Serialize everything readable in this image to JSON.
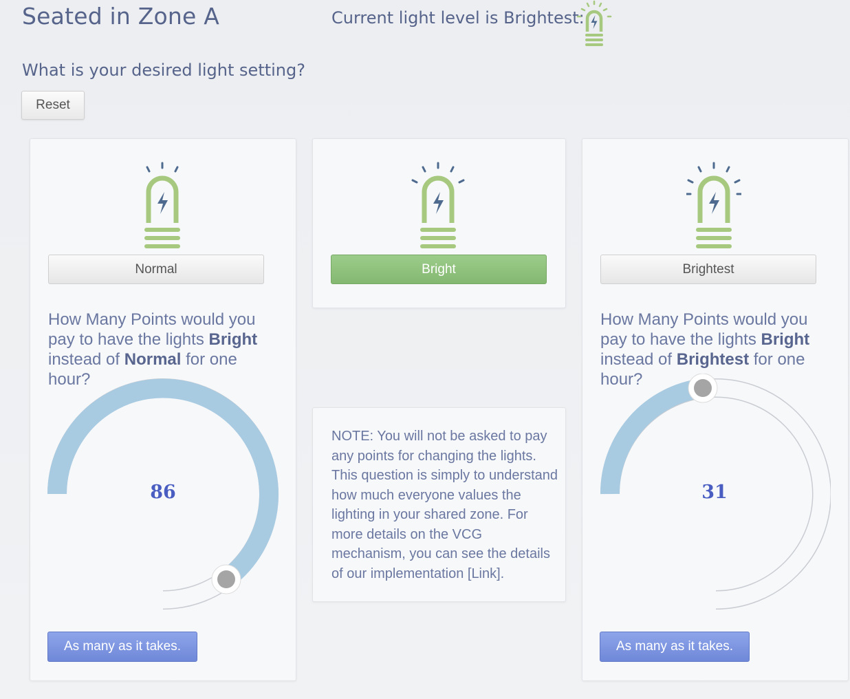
{
  "header": {
    "zone_title": "Seated in Zone A",
    "current_level_text": "Current light level is Brightest:",
    "question": "What is your desired light setting?",
    "reset_label": "Reset"
  },
  "options": [
    {
      "label": "Normal",
      "selected": false
    },
    {
      "label": "Bright",
      "selected": true
    },
    {
      "label": "Brightest",
      "selected": false
    }
  ],
  "left_panel": {
    "q_pre": "How Many Points would you pay to have the lights ",
    "q_bold1": "Bright",
    "q_mid": " instead of ",
    "q_bold2": "Normal",
    "q_post": " for one hour?",
    "value": "86",
    "button": "As many as it takes."
  },
  "right_panel": {
    "q_pre": "How Many Points would you pay to have the lights ",
    "q_bold1": "Bright",
    "q_mid": " instead of ",
    "q_bold2": "Brightest",
    "q_post": " for one hour?",
    "value": "31",
    "button": "As many as it takes."
  },
  "note": "NOTE: You will not be asked to pay any points for changing the lights. This question is simply to understand how much everyone values the lighting in your shared zone. For more details on the VCG mechanism, you can see the details of our implementation [Link].",
  "colors": {
    "bulb_green": "#a7c97f",
    "bulb_bolt": "#4e6a8e",
    "dial_fill": "#a8cbe2",
    "dial_track": "#c9ccd2",
    "selected_button": "#8cbf79",
    "action_button": "#7a92de"
  }
}
